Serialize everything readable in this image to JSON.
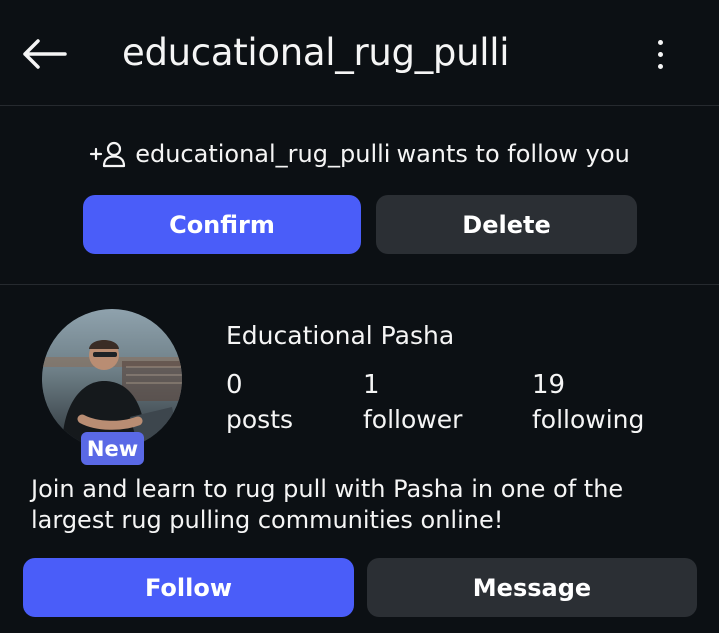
{
  "header": {
    "title": "educational_rug_pulli",
    "back_icon": "arrow-left-icon",
    "more_icon": "more-vertical-icon"
  },
  "request": {
    "username": "educational_rug_pulli",
    "message": "wants to follow you",
    "icon": "add-user-icon",
    "confirm_label": "Confirm",
    "delete_label": "Delete"
  },
  "profile": {
    "name": "Educational Pasha",
    "badge": "New",
    "stats": {
      "posts_count": "0",
      "posts_label": "posts",
      "followers_count": "1",
      "followers_label": "follower",
      "following_count": "19",
      "following_label": "following"
    },
    "bio": "Join and learn to rug pull with Pasha in one of the largest rug pulling communities online!",
    "follow_label": "Follow",
    "message_label": "Message"
  },
  "colors": {
    "background": "#0c1014",
    "primary": "#4a5df9",
    "secondary": "#2b2f34",
    "badge": "#5a69e6"
  }
}
